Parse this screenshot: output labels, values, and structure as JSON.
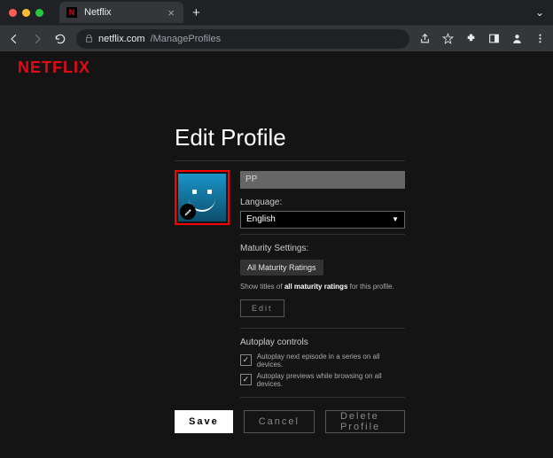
{
  "browser": {
    "tab_title": "Netflix",
    "url_host": "netflix.com",
    "url_path": "/ManageProfiles"
  },
  "logo": "NETFLIX",
  "heading": "Edit Profile",
  "profile": {
    "name_value": "PP",
    "language_label": "Language:",
    "language_value": "English"
  },
  "maturity": {
    "title": "Maturity Settings:",
    "badge": "All Maturity Ratings",
    "desc_prefix": "Show titles of ",
    "desc_bold": "all maturity ratings",
    "desc_suffix": " for this profile.",
    "edit_label": "Edit"
  },
  "autoplay": {
    "title": "Autoplay controls",
    "opt1": "Autoplay next episode in a series on all devices.",
    "opt2": "Autoplay previews while browsing on all devices."
  },
  "buttons": {
    "save": "Save",
    "cancel": "Cancel",
    "delete": "Delete Profile"
  }
}
